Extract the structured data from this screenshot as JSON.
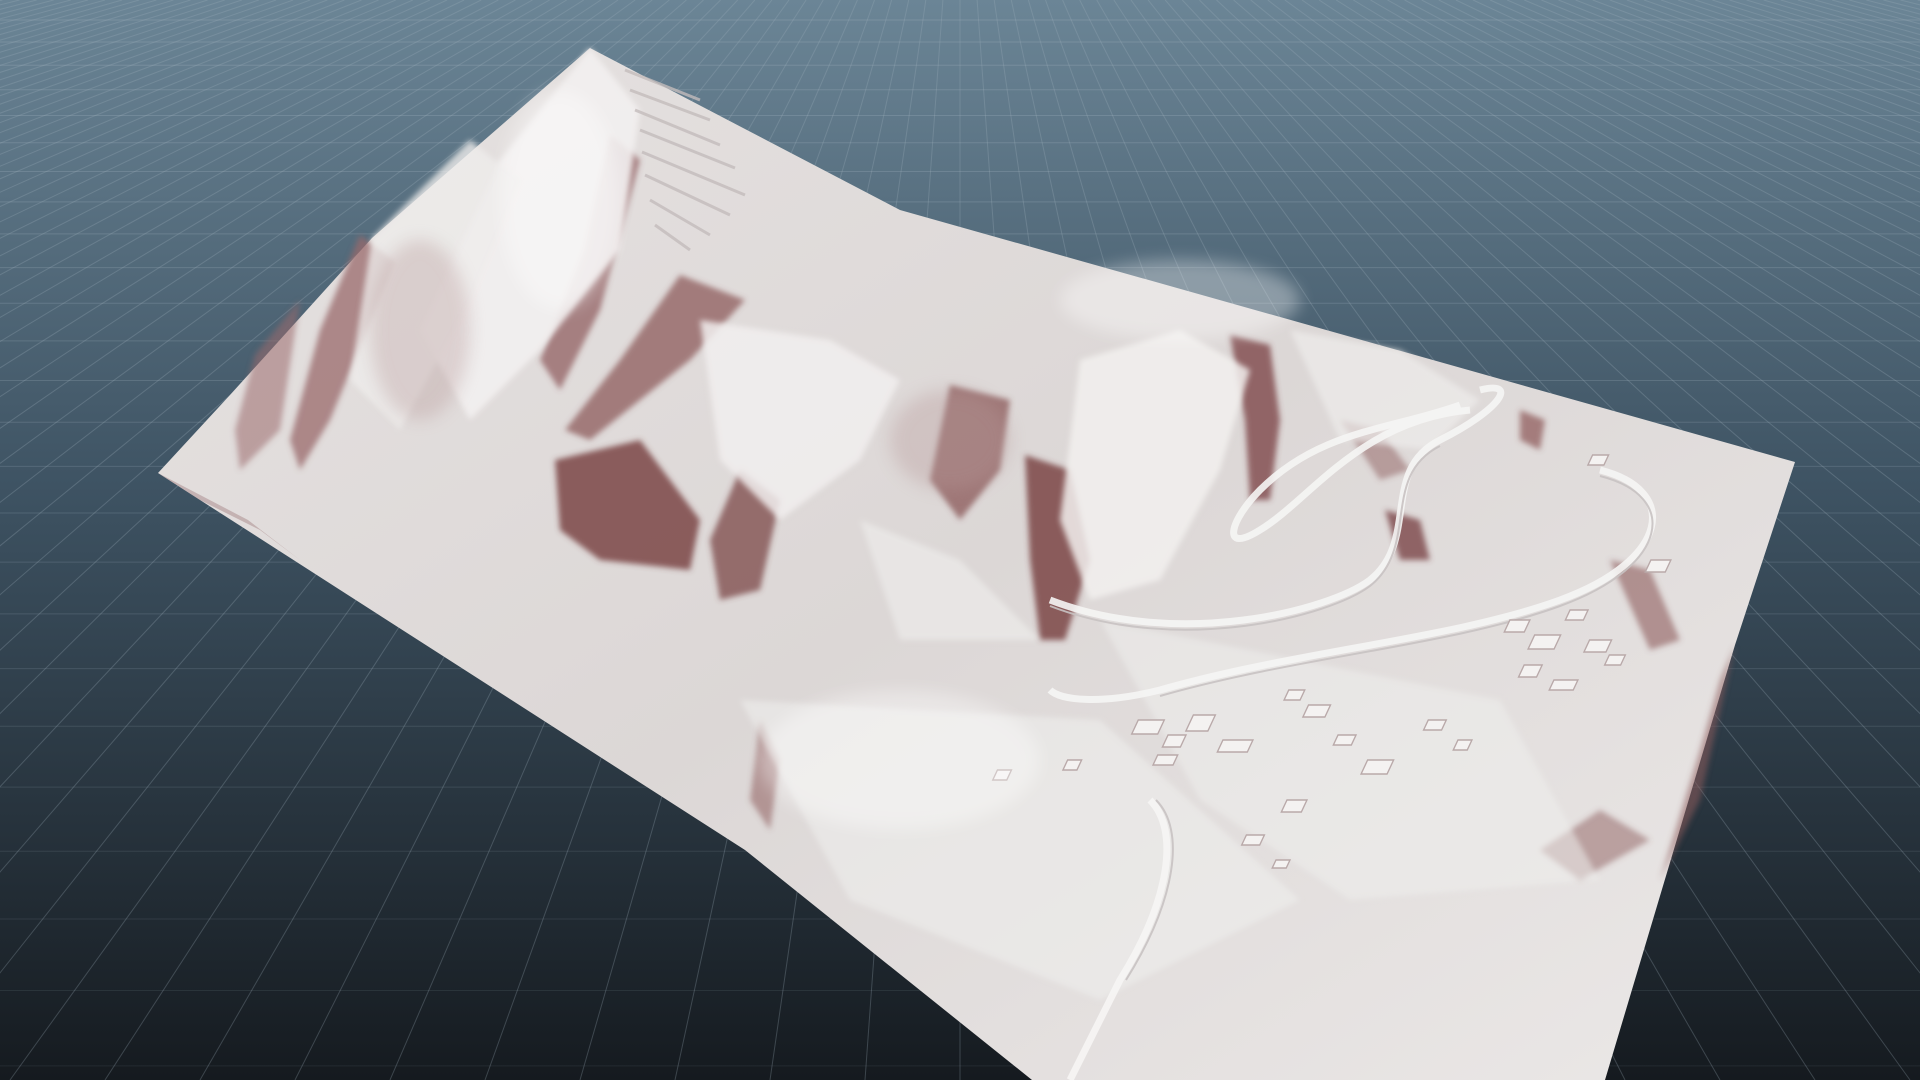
{
  "viewport": {
    "background_top": "#6b8596",
    "background_mid": "#3e5363",
    "background_bottom": "#151a1f",
    "grid_color": "#9fb0bc",
    "grid_visible": true
  },
  "terrain": {
    "surface_color": "#d9d4d3",
    "highlight_color": "#f3f1f0",
    "shadow_color": "#8a5a5a",
    "deep_shadow_color": "#6e3f40"
  }
}
